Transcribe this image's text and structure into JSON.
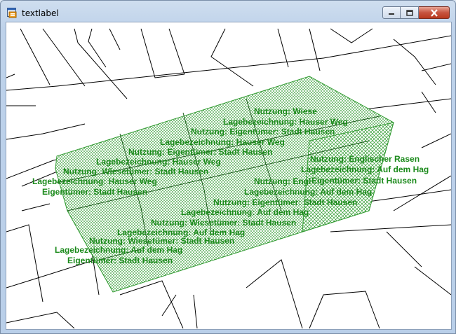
{
  "window": {
    "title": "textlabel"
  },
  "colors": {
    "label": "#1b8a1b",
    "hatch": "#2f9a2f",
    "lines": "#000000"
  },
  "icons": {
    "app": "app-icon",
    "minimize": "minimize-icon",
    "maximize": "maximize-icon",
    "close": "close-icon"
  },
  "labels": {
    "l1": "Nutzung: Wiese",
    "l2": "Lagebezeichnung: Hauser Weg",
    "l3": "Nutzung: Eigentümer: Stadt Hausen",
    "l4": "Lagebezeichnung: Hauser Weg",
    "l5": "Nutzung: Eigentümer: Stadt Hausen",
    "l6": "Nutzung: Englischer Rasen",
    "l7": "Lagebezeichnung: Hauser Weg",
    "l8": "Lagebezeichnung: Auf dem Hag",
    "l9": "Nutzung: Wiesetümer: Stadt Hausen",
    "l10": "Eigentümer: Stadt Hausen",
    "l11": "Nutzung: Engl",
    "l12": "Lagebezeichnung: Hauser Weg",
    "l13": "Lagebezeichnung: Auf dem Hag",
    "l14": "Eigentümer: Stadt Hausen",
    "l15": "Nutzung: Eigentümer: Stadt Hausen",
    "l16": "Lagebezeichnung: Auf dem Hag",
    "l17": "Nutzung: Wiesetümer: Stadt Hausen",
    "l18": "Lagebezeichnung: Auf dem Hag",
    "l19": "Nutzung: Wiesetümer: Stadt Hausen",
    "l20": "Lagebezeichnung: Auf dem Hag",
    "l21": "Eigentümer: Stadt Hausen"
  }
}
